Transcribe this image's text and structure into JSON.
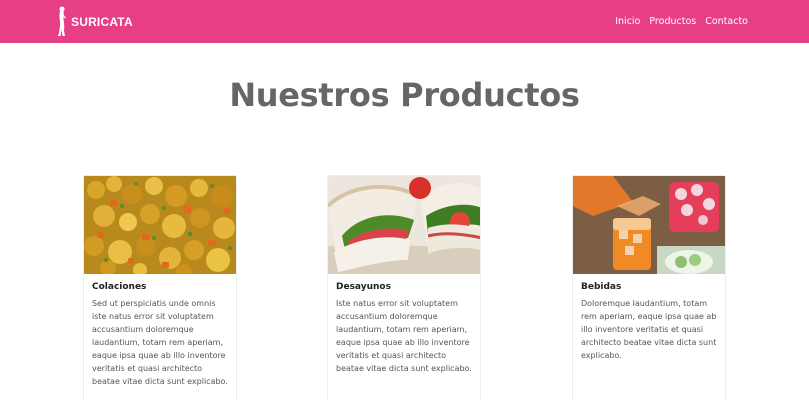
{
  "navbar": {
    "brand": "SURICATA",
    "links": [
      {
        "label": "Inicio"
      },
      {
        "label": "Productos"
      },
      {
        "label": "Contacto"
      }
    ],
    "background": "#e63f86"
  },
  "main": {
    "title": "Nuestros Productos",
    "cards": [
      {
        "title": "Colaciones",
        "text": "Sed ut perspiciatis unde omnis iste natus error sit voluptatem accusantium doloremque laudantium, totam rem aperiam, eaque ipsa quae ab illo inventore veritatis et quasi architecto beatae vitae dicta sunt explicabo.",
        "image": "food-image"
      },
      {
        "title": "Desayunos",
        "text": "Iste natus error sit voluptatem accusantium doloremque laudantium, totam rem aperiam, eaque ipsa quae ab illo inventore veritatis et quasi architecto beatae vitae dicta sunt explicabo.",
        "image": "sandwich-image"
      },
      {
        "title": "Bebidas",
        "text": "Doloremque laudantium, totam rem aperiam, eaque ipsa quae ab illo inventore veritatis et quasi architecto beatae vitae dicta sunt explicabo.",
        "image": "drinks-image"
      }
    ]
  }
}
